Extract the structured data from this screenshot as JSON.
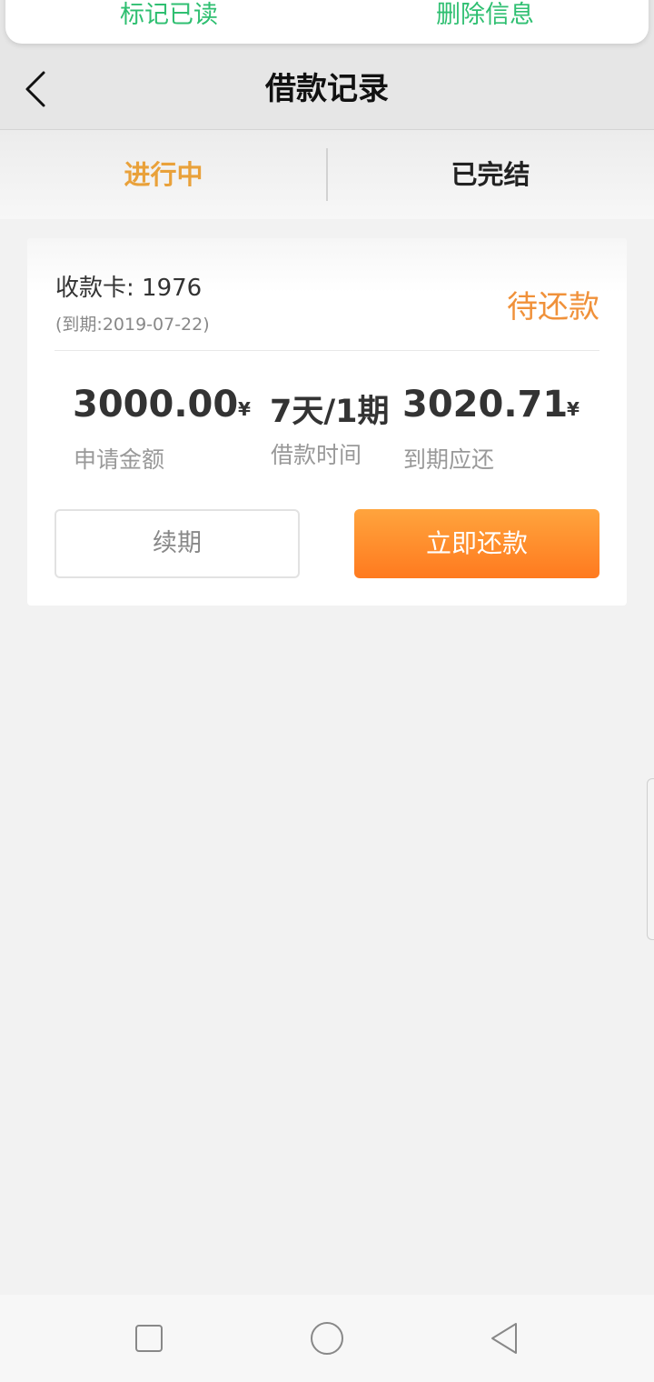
{
  "notification": {
    "mark_read_label": "标记已读",
    "delete_label": "删除信息"
  },
  "header": {
    "title": "借款记录",
    "back_icon": "chevron-left-icon"
  },
  "tabs": [
    {
      "label": "进行中",
      "active": true
    },
    {
      "label": "已完结",
      "active": false
    }
  ],
  "loan_card": {
    "card_label": "收款卡: 1976",
    "due_text": "(到期:2019-07-22)",
    "status": "待还款",
    "amount": "3000.00",
    "amount_currency": "¥",
    "amount_label": "申请金额",
    "term": "7天/1期",
    "term_label": "借款时间",
    "due_amount": "3020.71",
    "due_currency": "¥",
    "due_amount_label": "到期应还",
    "renew_label": "续期",
    "repay_label": "立即还款"
  },
  "colors": {
    "accent": "#e9a13a",
    "status": "#f0913a",
    "notification_text": "#2fbf71",
    "repay_button": "#ff8a2a"
  },
  "nav": {
    "recent_icon": "square-icon",
    "home_icon": "circle-icon",
    "back_icon": "triangle-back-icon"
  }
}
